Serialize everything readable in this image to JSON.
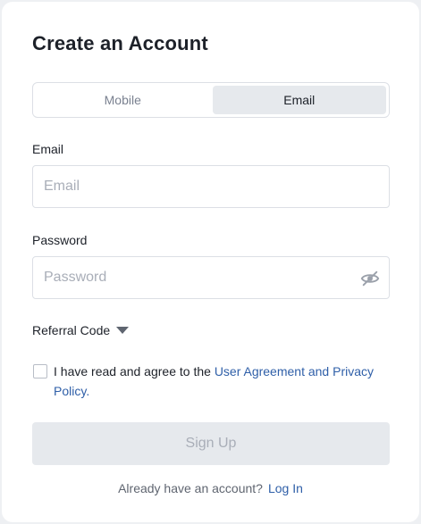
{
  "form": {
    "title": "Create an Account",
    "tabs": [
      {
        "label": "Mobile",
        "active": false
      },
      {
        "label": "Email",
        "active": true
      }
    ],
    "email": {
      "label": "Email",
      "placeholder": "Email",
      "value": ""
    },
    "password": {
      "label": "Password",
      "placeholder": "Password",
      "value": "",
      "visibility_icon": "eye-slash-icon"
    },
    "referral": {
      "label": "Referral Code",
      "icon": "caret-down-icon"
    },
    "agreement": {
      "checked": false,
      "prefix": "I have read and agree to the ",
      "link_text": "User Agreement and Privacy Policy",
      "suffix": "."
    },
    "signup_label": "Sign Up",
    "footer": {
      "prompt": "Already have an account?",
      "login_label": "Log In"
    }
  },
  "colors": {
    "link": "#2f5fa8",
    "active_tab_bg": "#e6e9ed",
    "disabled_button_bg": "#e6e9ed",
    "placeholder": "#a9aeb8"
  }
}
